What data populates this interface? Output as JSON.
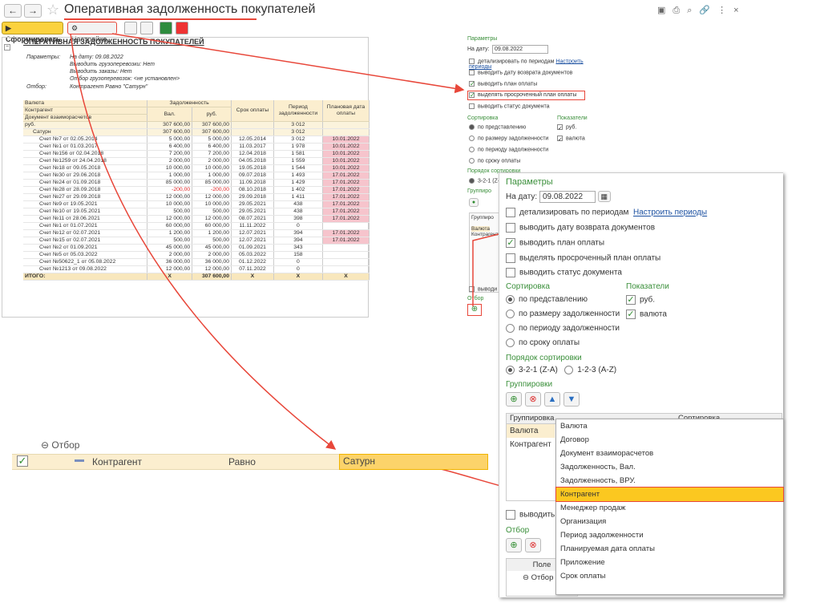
{
  "header": {
    "back": "←",
    "fwd": "→",
    "title": "Оперативная задолженность покупателей"
  },
  "toolbar": {
    "generate": "Сформировать",
    "settings": "Настройка"
  },
  "report": {
    "title": "ОПЕРАТИВНАЯ ЗАДОЛЖЕННОСТЬ ПОКУПАТЕЛЕЙ",
    "params_label": "Параметры:",
    "selection_label": "Отбор:",
    "params": [
      "На дату: 09.08.2022",
      "Выводить грузоперевозки: Нет",
      "Выводить заказы: Нет",
      "Отбор грузоперевозок: <не установлен>"
    ],
    "selection": "Контрагент Равно \"Сатурн\"",
    "headers": {
      "currency": "Валюта",
      "counterparty": "Контрагент",
      "doc": "Документ взаиморасчетов",
      "debt": "Задолженность",
      "val": "Вал.",
      "rub": "руб.",
      "term": "Срок оплаты",
      "period": "Период задолженности",
      "plan": "Плановая дата оплаты"
    },
    "group": {
      "name": "руб.",
      "val": "307 600,00",
      "rub": "307 600,00",
      "period": "3 012"
    },
    "sub": {
      "name": "Сатурн",
      "val": "307 600,00",
      "rub": "307 600,00",
      "period": "3 012"
    },
    "rows": [
      [
        "Счет №7 от 02.05.2014",
        "5 000,00",
        "5 000,00",
        "12.05.2014",
        "3 012",
        "10.01.2022"
      ],
      [
        "Счет №1 от 01.03.2017",
        "6 400,00",
        "6 400,00",
        "11.03.2017",
        "1 978",
        "10.01.2022"
      ],
      [
        "Счет №156 от 02.04.2018",
        "7 200,00",
        "7 200,00",
        "12.04.2018",
        "1 581",
        "10.01.2022"
      ],
      [
        "Счет №1259 от 24.04.2018",
        "2 000,00",
        "2 000,00",
        "04.05.2018",
        "1 559",
        "10.01.2022"
      ],
      [
        "Счет №18 от 09.05.2018",
        "10 000,00",
        "10 000,00",
        "19.05.2018",
        "1 544",
        "10.01.2022"
      ],
      [
        "Счет №30 от 29.06.2018",
        "1 000,00",
        "1 000,00",
        "09.07.2018",
        "1 493",
        "17.01.2022"
      ],
      [
        "Счет №24 от 01.09.2018",
        "85 000,00",
        "85 000,00",
        "11.09.2018",
        "1 429",
        "17.01.2022"
      ],
      [
        "Счет №28 от 28.09.2018",
        "-200,00",
        "-200,00",
        "08.10.2018",
        "1 402",
        "17.01.2022"
      ],
      [
        "Счет №27 от 29.09.2018",
        "12 000,00",
        "12 000,00",
        "29.09.2018",
        "1 411",
        "17.01.2022"
      ],
      [
        "Счет №9 от 19.05.2021",
        "10 000,00",
        "10 000,00",
        "29.05.2021",
        "438",
        "17.01.2022"
      ],
      [
        "Счет №10 от 19.05.2021",
        "500,00",
        "500,00",
        "29.05.2021",
        "438",
        "17.01.2022"
      ],
      [
        "Счет №11 от 28.06.2021",
        "12 000,00",
        "12 000,00",
        "08.07.2021",
        "398",
        "17.01.2022"
      ],
      [
        "Счет №1 от 01.07.2021",
        "60 000,00",
        "60 000,00",
        "11.11.2022",
        "0",
        ""
      ],
      [
        "Счет №12 от 02.07.2021",
        "1 200,00",
        "1 200,00",
        "12.07.2021",
        "394",
        "17.01.2022"
      ],
      [
        "Счет №15 от 02.07.2021",
        "500,00",
        "500,00",
        "12.07.2021",
        "394",
        "17.01.2022"
      ],
      [
        "Счет №2 от 01.09.2021",
        "45 000,00",
        "45 000,00",
        "01.09.2021",
        "343",
        ""
      ],
      [
        "Счет №5 от 05.03.2022",
        "2 000,00",
        "2 000,00",
        "05.03.2022",
        "158",
        ""
      ],
      [
        "Счет №50622_1 от 05.08.2022",
        "36 000,00",
        "36 000,00",
        "01.12.2022",
        "0",
        ""
      ],
      [
        "Счет №1213 от 09.08.2022",
        "12 000,00",
        "12 000,00",
        "07.11.2022",
        "0",
        ""
      ]
    ],
    "total": {
      "label": "ИТОГО:",
      "val": "X",
      "rub": "307 600,00",
      "term": "X",
      "period": "X",
      "plan": "X"
    }
  },
  "panel": {
    "params": "Параметры",
    "on_date": "На дату:",
    "date": "09.08.2022",
    "opt1": "детализировать по периодам",
    "link": "Настроить периоды",
    "opt2": "выводить дату возврата документов",
    "opt3": "выводить план оплаты",
    "opt4": "выделять просроченный план оплаты",
    "opt5": "выводить статус документа",
    "sort": "Сортировка",
    "indicators": "Показатели",
    "s1": "по представлению",
    "s2": "по размеру задолженности",
    "s3": "по периоду задолженности",
    "s4": "по сроку оплаты",
    "i1": "руб.",
    "i2": "валюта",
    "order": "Порядок сортировки",
    "o1": "3-2-1 (Z-A)",
    "o2": "1-2-3 (A-Z)",
    "groupings": "Группировки",
    "col_grouping": "Группировка",
    "col_sort": "Сортировка",
    "g1": "Валюта",
    "g2": "Контрагент",
    "out": "выводить",
    "filter": "Отбор",
    "field": "Поле",
    "filter_node": "Отбор"
  },
  "dropdown": [
    "Валюта",
    "Договор",
    "Документ взаиморасчетов",
    "Задолженность, Вал.",
    "Задолженность, ВРУ.",
    "Контрагент",
    "Менеджер продаж",
    "Организация",
    "Период задолженности",
    "Планируемая дата оплаты",
    "Приложение",
    "Срок оплаты"
  ],
  "filter_zoom": {
    "title": "Отбор",
    "field": "Контрагент",
    "cond": "Равно",
    "value": "Сатурн"
  }
}
